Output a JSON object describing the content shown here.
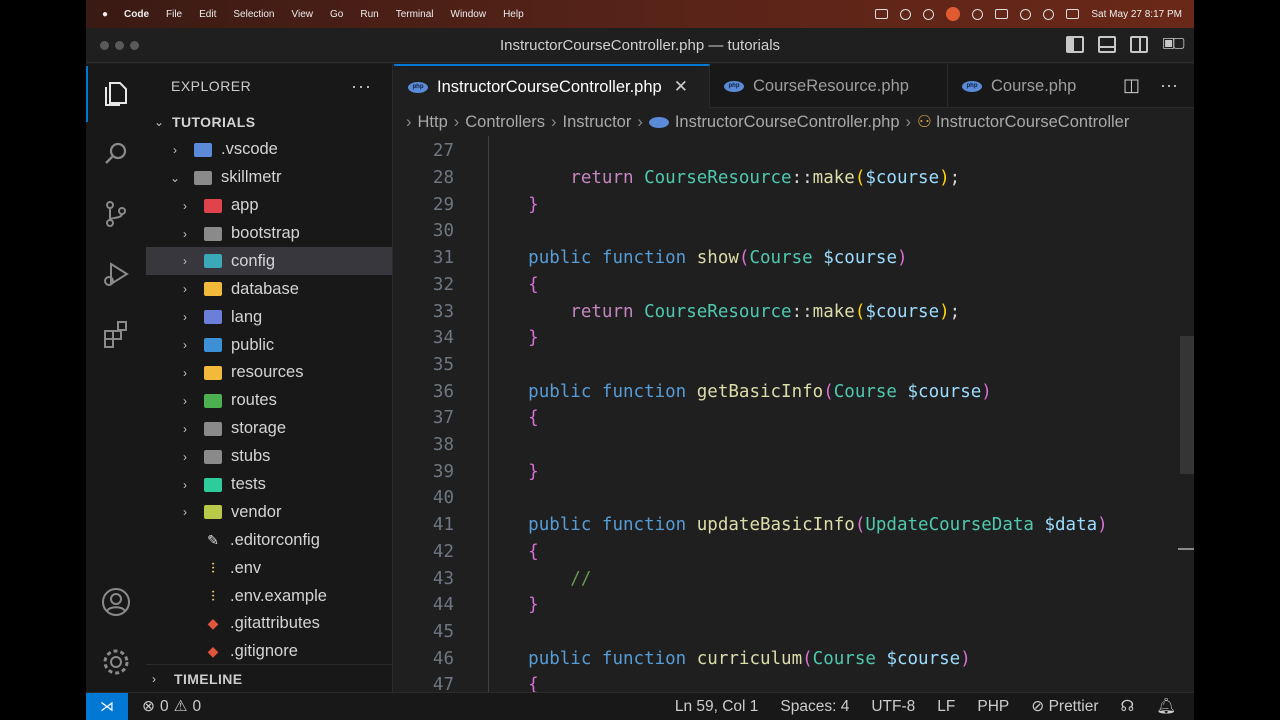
{
  "menubar": {
    "app": "Code",
    "items": [
      "File",
      "Edit",
      "Selection",
      "View",
      "Go",
      "Run",
      "Terminal",
      "Window",
      "Help"
    ],
    "datetime": "Sat May 27  8:17 PM"
  },
  "window": {
    "title": "InstructorCourseController.php — tutorials"
  },
  "explorer": {
    "title": "EXPLORER",
    "more": "···",
    "root": "TUTORIALS",
    "tree": [
      {
        "label": ".vscode",
        "depth": 1,
        "kind": "folder",
        "chev": "›",
        "color": "#5a8ad8"
      },
      {
        "label": "skillmetr",
        "depth": 1,
        "kind": "folder-open",
        "chev": "⌄",
        "color": "#8a8a8a"
      },
      {
        "label": "app",
        "depth": 2,
        "kind": "folder",
        "chev": "›",
        "color": "#e0434b"
      },
      {
        "label": "bootstrap",
        "depth": 2,
        "kind": "folder",
        "chev": "›",
        "color": "#8a8a8a"
      },
      {
        "label": "config",
        "depth": 2,
        "kind": "folder",
        "chev": "›",
        "color": "#3aa9b8"
      },
      {
        "label": "database",
        "depth": 2,
        "kind": "folder",
        "chev": "›",
        "color": "#f2b93b"
      },
      {
        "label": "lang",
        "depth": 2,
        "kind": "folder",
        "chev": "›",
        "color": "#6c7fd8"
      },
      {
        "label": "public",
        "depth": 2,
        "kind": "folder",
        "chev": "›",
        "color": "#3d8fd6"
      },
      {
        "label": "resources",
        "depth": 2,
        "kind": "folder",
        "chev": "›",
        "color": "#f2b93b"
      },
      {
        "label": "routes",
        "depth": 2,
        "kind": "folder",
        "chev": "›",
        "color": "#4caf50"
      },
      {
        "label": "storage",
        "depth": 2,
        "kind": "folder",
        "chev": "›",
        "color": "#8a8a8a"
      },
      {
        "label": "stubs",
        "depth": 2,
        "kind": "folder",
        "chev": "›",
        "color": "#8a8a8a"
      },
      {
        "label": "tests",
        "depth": 2,
        "kind": "folder",
        "chev": "›",
        "color": "#2ecc9a"
      },
      {
        "label": "vendor",
        "depth": 2,
        "kind": "folder",
        "chev": "›",
        "color": "#b8c94a"
      },
      {
        "label": ".editorconfig",
        "depth": 2,
        "kind": "file",
        "glyph": "✎",
        "color": "#e0e0e0"
      },
      {
        "label": ".env",
        "depth": 2,
        "kind": "file",
        "glyph": "⫶",
        "color": "#e8c46a"
      },
      {
        "label": ".env.example",
        "depth": 2,
        "kind": "file",
        "glyph": "⫶",
        "color": "#e8c46a"
      },
      {
        "label": ".gitattributes",
        "depth": 2,
        "kind": "file",
        "glyph": "◆",
        "color": "#e0533d"
      },
      {
        "label": ".gitignore",
        "depth": 2,
        "kind": "file",
        "glyph": "◆",
        "color": "#e0533d"
      }
    ],
    "selected": "config",
    "timeline": "TIMELINE"
  },
  "tabs": [
    {
      "label": "InstructorCourseController.php",
      "active": true,
      "close": "✕"
    },
    {
      "label": "CourseResource.php",
      "active": false
    },
    {
      "label": "Course.php",
      "active": false
    }
  ],
  "breadcrumb": [
    "Http",
    "Controllers",
    "Instructor",
    "InstructorCourseController.php",
    "InstructorCourseController"
  ],
  "editor": {
    "first_line": 27,
    "lines": [
      {
        "n": "27",
        "html": ""
      },
      {
        "n": "28",
        "html": "        <span class='r'>return</span> <span class='t'>CourseResource</span><span class='p'>::</span><span class='f'>make</span><span class='b2'>(</span><span class='v'>$course</span><span class='b2'>)</span><span class='p'>;</span>"
      },
      {
        "n": "29",
        "html": "    <span class='b1'>}</span>"
      },
      {
        "n": "30",
        "html": ""
      },
      {
        "n": "31",
        "html": "    <span class='k'>public</span> <span class='k'>function</span> <span class='f'>show</span><span class='b1'>(</span><span class='t'>Course</span> <span class='v'>$course</span><span class='b1'>)</span>"
      },
      {
        "n": "32",
        "html": "    <span class='b1'>{</span>"
      },
      {
        "n": "33",
        "html": "        <span class='r'>return</span> <span class='t'>CourseResource</span><span class='p'>::</span><span class='f'>make</span><span class='b2'>(</span><span class='v'>$course</span><span class='b2'>)</span><span class='p'>;</span>"
      },
      {
        "n": "34",
        "html": "    <span class='b1'>}</span>"
      },
      {
        "n": "35",
        "html": ""
      },
      {
        "n": "36",
        "html": "    <span class='k'>public</span> <span class='k'>function</span> <span class='f'>getBasicInfo</span><span class='b1'>(</span><span class='t'>Course</span> <span class='v'>$course</span><span class='b1'>)</span>"
      },
      {
        "n": "37",
        "html": "    <span class='b1'>{</span>"
      },
      {
        "n": "38",
        "html": ""
      },
      {
        "n": "39",
        "html": "    <span class='b1'>}</span>"
      },
      {
        "n": "40",
        "html": ""
      },
      {
        "n": "41",
        "html": "    <span class='k'>public</span> <span class='k'>function</span> <span class='f'>updateBasicInfo</span><span class='b1'>(</span><span class='t'>UpdateCourseData</span> <span class='v'>$data</span><span class='b1'>)</span>"
      },
      {
        "n": "42",
        "html": "    <span class='b1'>{</span>"
      },
      {
        "n": "43",
        "html": "        <span class='c'>//</span>"
      },
      {
        "n": "44",
        "html": "    <span class='b1'>}</span>"
      },
      {
        "n": "45",
        "html": ""
      },
      {
        "n": "46",
        "html": "    <span class='k'>public</span> <span class='k'>function</span> <span class='f'>curriculum</span><span class='b1'>(</span><span class='t'>Course</span> <span class='v'>$course</span><span class='b1'>)</span>"
      },
      {
        "n": "47",
        "html": "    <span class='b1'>{</span>"
      }
    ]
  },
  "statusbar": {
    "errors": "0",
    "warnings": "0",
    "position": "Ln 59, Col 1",
    "spaces": "Spaces: 4",
    "encoding": "UTF-8",
    "eol": "LF",
    "language": "PHP",
    "formatter": "Prettier"
  }
}
